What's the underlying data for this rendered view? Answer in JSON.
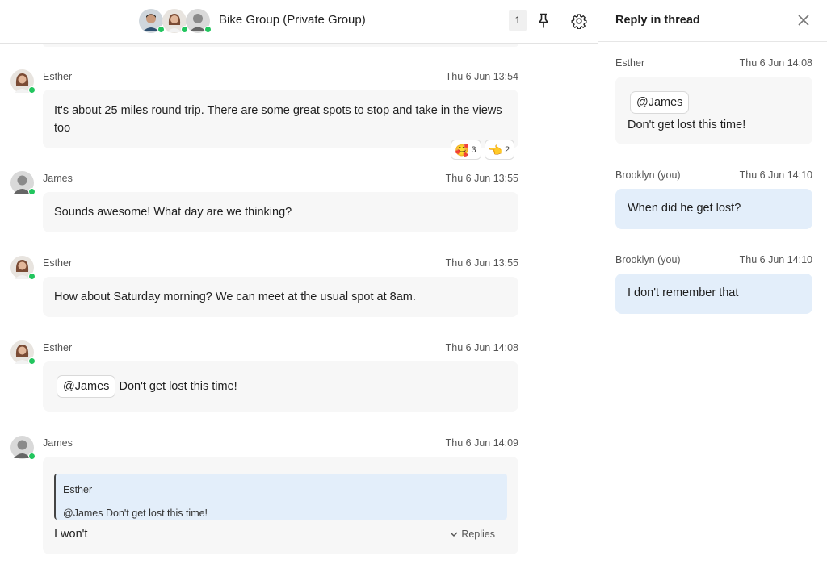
{
  "header": {
    "group_title": "Bike Group (Private Group)",
    "pin_count": "1",
    "icons": [
      "pin-icon",
      "gear-icon"
    ]
  },
  "messages": [
    {
      "sender": "Esther",
      "time": "Thu 6 Jun 13:54",
      "text": "It's about 25 miles round trip. There are some great spots to stop and take in the views too",
      "reactions": [
        {
          "emoji": "🥰",
          "count": "3"
        },
        {
          "emoji": "👈",
          "count": "2"
        }
      ]
    },
    {
      "sender": "James",
      "time": "Thu 6 Jun 13:55",
      "text": "Sounds awesome! What day are we thinking?"
    },
    {
      "sender": "Esther",
      "time": "Thu 6 Jun 13:55",
      "text": "How about Saturday morning? We can meet at the usual spot at 8am."
    },
    {
      "sender": "Esther",
      "time": "Thu 6 Jun 14:08",
      "mention": "@James",
      "text": "Don't get lost this time!"
    },
    {
      "sender": "James",
      "time": "Thu 6 Jun 14:09",
      "quote_name": "Esther",
      "quote_text": "@James Don't get lost this time!",
      "text": "I won't",
      "replies_label": "Replies"
    }
  ],
  "thread": {
    "title": "Reply in thread",
    "messages": [
      {
        "sender": "Esther",
        "time": "Thu 6 Jun 14:08",
        "mention": "@James",
        "text": "Don't get lost this time!"
      },
      {
        "sender": "Brooklyn (you)",
        "time": "Thu 6 Jun 14:10",
        "text": "When did he get lost?"
      },
      {
        "sender": "Brooklyn (you)",
        "time": "Thu 6 Jun 14:10",
        "text": "I don't remember that"
      }
    ]
  },
  "colors": {
    "online": "#22c55e",
    "bubble_grey": "#f7f7f7",
    "bubble_blue": "#e3eefa"
  }
}
